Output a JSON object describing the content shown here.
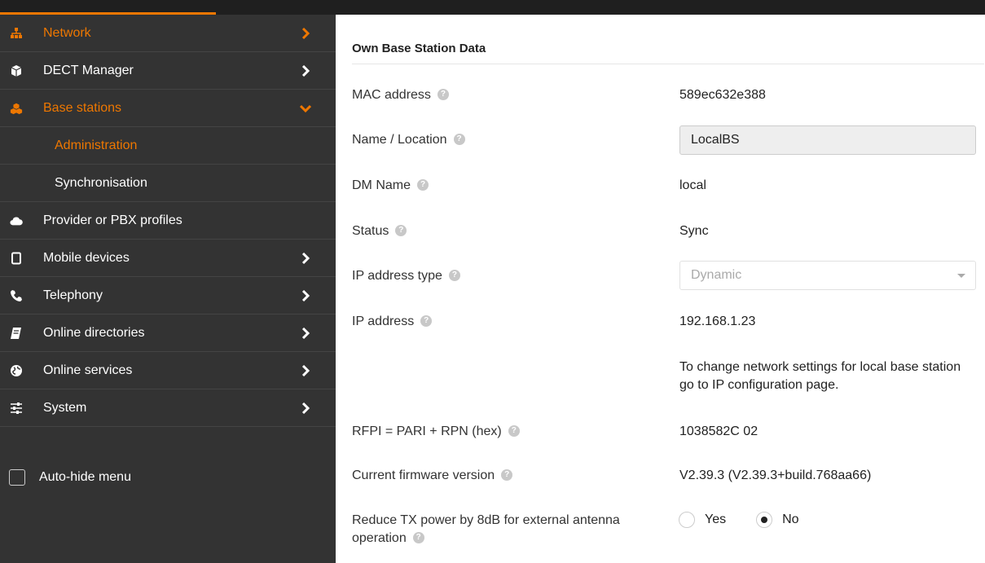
{
  "sidebar": {
    "items": [
      {
        "label": "Network",
        "icon": "network-icon",
        "state": "active",
        "chevron": "right"
      },
      {
        "label": "DECT Manager",
        "icon": "cube-icon",
        "chevron": "right"
      },
      {
        "label": "Base stations",
        "icon": "cubes-icon",
        "state": "active",
        "chevron": "down"
      },
      {
        "label": "Administration",
        "sub": true,
        "state": "active"
      },
      {
        "label": "Synchronisation",
        "sub": true
      },
      {
        "label": "Provider or PBX profiles",
        "icon": "cloud-icon"
      },
      {
        "label": "Mobile devices",
        "icon": "mobile-icon",
        "chevron": "right"
      },
      {
        "label": "Telephony",
        "icon": "phone-icon",
        "chevron": "right"
      },
      {
        "label": "Online directories",
        "icon": "book-icon",
        "chevron": "right"
      },
      {
        "label": "Online services",
        "icon": "globe-icon",
        "chevron": "right"
      },
      {
        "label": "System",
        "icon": "sliders-icon",
        "chevron": "right"
      }
    ],
    "autohide_label": "Auto-hide menu",
    "autohide_checked": false
  },
  "colors": {
    "accent": "#ee7700",
    "sidebar_bg": "#333333",
    "topbar": "#1f1f1f"
  },
  "main": {
    "section_title": "Own Base Station Data",
    "fields": {
      "mac": {
        "label": "MAC address",
        "value": "589ec632e388"
      },
      "name": {
        "label": "Name / Location",
        "value": "LocalBS"
      },
      "dm": {
        "label": "DM Name",
        "value": "local"
      },
      "status": {
        "label": "Status",
        "value": "Sync"
      },
      "ip_type": {
        "label": "IP address type",
        "value": "Dynamic"
      },
      "ip": {
        "label": "IP address",
        "value": "192.168.1.23"
      },
      "note": "To change network settings for local base station go to IP configuration page.",
      "rfpi": {
        "label": "RFPI = PARI + RPN (hex)",
        "value": "1038582C 02"
      },
      "firmware": {
        "label": "Current firmware version",
        "value": "V2.39.3 (V2.39.3+build.768aa66)"
      },
      "tx": {
        "label": "Reduce TX power by 8dB for external antenna operation",
        "options": [
          "Yes",
          "No"
        ],
        "selected": "No"
      }
    }
  }
}
